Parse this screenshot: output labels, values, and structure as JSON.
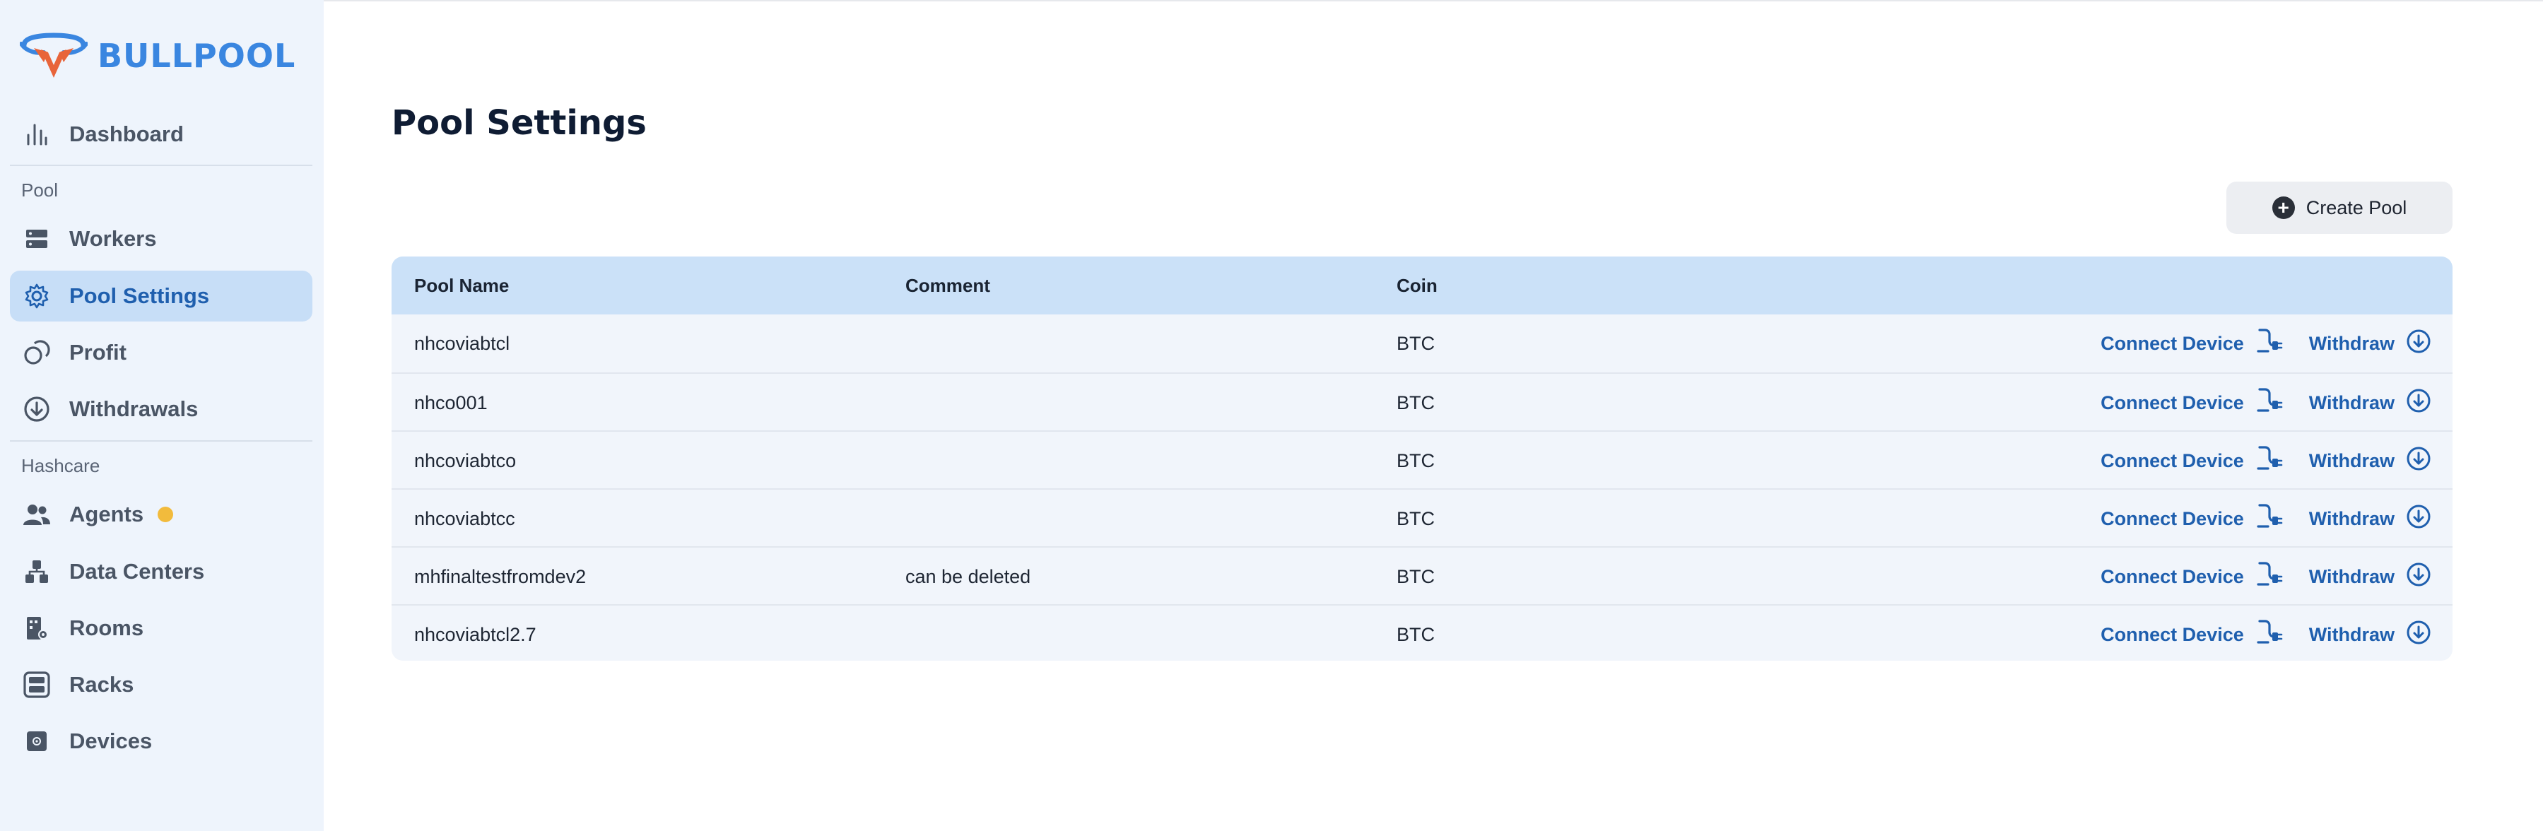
{
  "brand": {
    "name": "BULLPOOL"
  },
  "sidebar": {
    "items": [
      {
        "label": "Dashboard",
        "icon": "bar-chart-icon"
      },
      {
        "label": "Workers",
        "icon": "server-icon"
      },
      {
        "label": "Pool Settings",
        "icon": "gear-icon",
        "active": true
      },
      {
        "label": "Profit",
        "icon": "coins-icon"
      },
      {
        "label": "Withdrawals",
        "icon": "download-circle-icon"
      },
      {
        "label": "Agents",
        "icon": "users-icon"
      },
      {
        "label": "Data Centers",
        "icon": "hierarchy-icon"
      },
      {
        "label": "Rooms",
        "icon": "room-icon"
      },
      {
        "label": "Racks",
        "icon": "rack-icon"
      },
      {
        "label": "Devices",
        "icon": "chip-icon"
      }
    ],
    "sections": {
      "pool": "Pool",
      "hashcare": "Hashcare"
    }
  },
  "page": {
    "title": "Pool Settings"
  },
  "toolbar": {
    "create_label": "Create Pool"
  },
  "table": {
    "headers": [
      "Pool Name",
      "Comment",
      "Coin"
    ],
    "rows": [
      {
        "name": "nhcoviabtcl",
        "comment": "",
        "coin": "BTC"
      },
      {
        "name": "nhco001",
        "comment": "",
        "coin": "BTC"
      },
      {
        "name": "nhcoviabtco",
        "comment": "",
        "coin": "BTC"
      },
      {
        "name": "nhcoviabtcc",
        "comment": "",
        "coin": "BTC"
      },
      {
        "name": "mhfinaltestfromdev2",
        "comment": "can be deleted",
        "coin": "BTC"
      },
      {
        "name": "nhcoviabtcl2.7",
        "comment": "",
        "coin": "BTC"
      }
    ],
    "actions": {
      "connect": "Connect Device",
      "withdraw": "Withdraw"
    }
  },
  "colors": {
    "accent": "#1f5fae",
    "sidebar_bg": "#eef4fc",
    "header_bg": "#cbe1f8",
    "badge": "#f2bb3c"
  }
}
